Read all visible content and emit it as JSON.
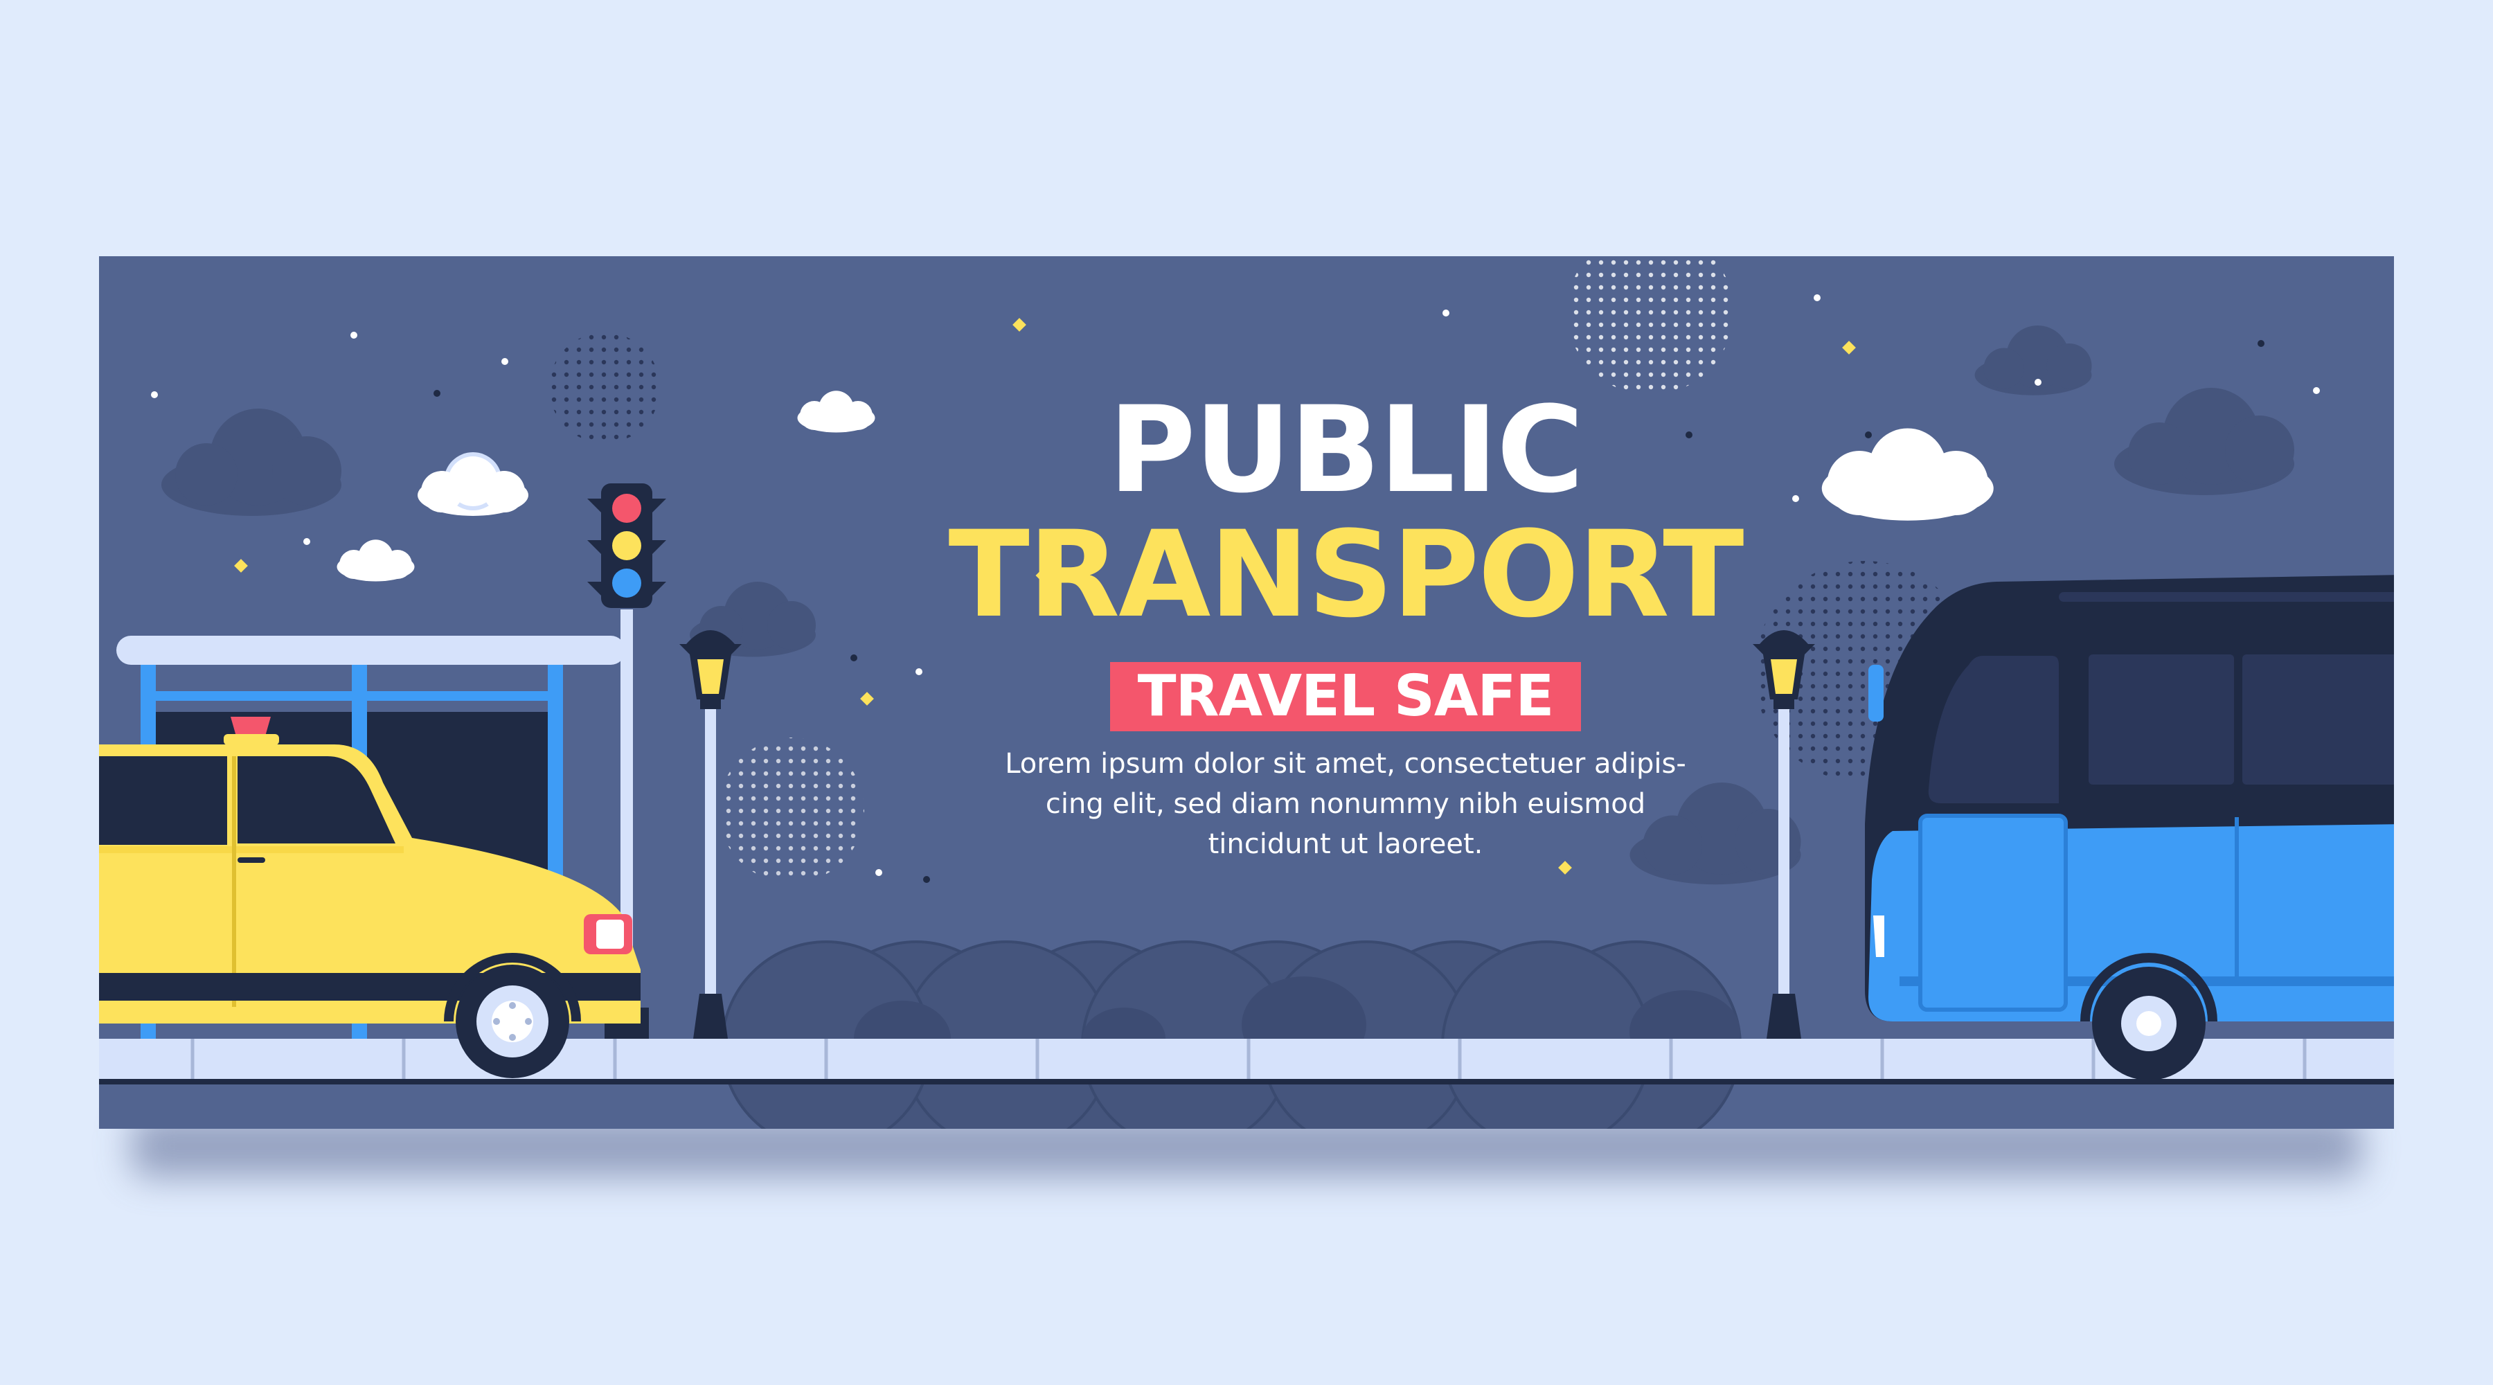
{
  "banner": {
    "title_line1": "PUBLIC",
    "title_line2": "TRANSPORT",
    "tagline": "TRAVEL SAFE",
    "body": "Lorem ipsum dolor sit amet, consectetuer adipis-cing elit, sed diam nonummy nibh euismod tincidunt ut laoreet."
  },
  "colors": {
    "page_background": "#e0ebfc",
    "banner_background": "#526490",
    "title_white": "#ffffff",
    "title_yellow": "#fde25c",
    "tag_red": "#f4566c",
    "taxi_yellow": "#fde25c",
    "bus_blue": "#3e9cf6",
    "bus_dark": "#1f2a44"
  },
  "icons": [
    "cloud-icon",
    "sparkle-icon",
    "traffic-light-icon",
    "street-lamp-icon",
    "taxi-icon",
    "bus-icon",
    "bus-stop-icon"
  ]
}
